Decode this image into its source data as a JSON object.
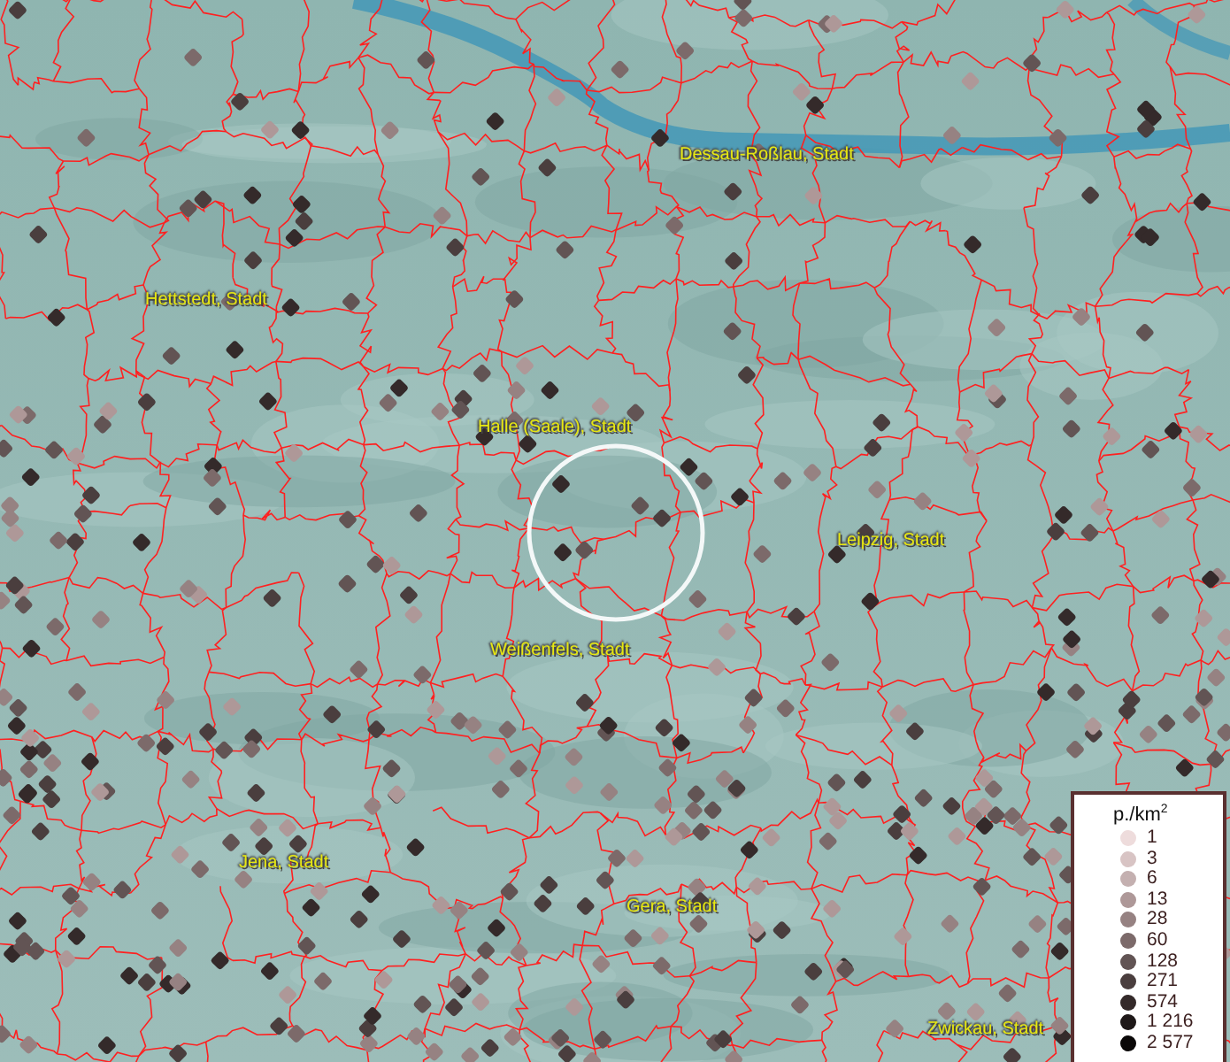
{
  "map": {
    "places": [
      {
        "name": "Dessau-Roßlau, Stadt"
      },
      {
        "name": "Hettstedt, Stadt"
      },
      {
        "name": "Halle (Saale), Stadt"
      },
      {
        "name": "Leipzig, Stadt"
      },
      {
        "name": "Weißenfels, Stadt"
      },
      {
        "name": "Jena, Stadt"
      },
      {
        "name": "Gera, Stadt"
      },
      {
        "name": "Zwickau, Stadt"
      }
    ]
  },
  "legend": {
    "title": "p./km$^{2}$",
    "entries": [
      {
        "label": "1",
        "color": "#eedcdc"
      },
      {
        "label": "3",
        "color": "#d8c4c4"
      },
      {
        "label": "6",
        "color": "#c4b0b0"
      },
      {
        "label": "13",
        "color": "#ae9898"
      },
      {
        "label": "28",
        "color": "#968282"
      },
      {
        "label": "60",
        "color": "#7c6a6a"
      },
      {
        "label": "128",
        "color": "#625454"
      },
      {
        "label": "271",
        "color": "#4a3e3e"
      },
      {
        "label": "574",
        "color": "#342a2a"
      },
      {
        "label": "1 216",
        "color": "#1e1818"
      },
      {
        "label": "2 577",
        "color": "#0a0808"
      }
    ]
  }
}
